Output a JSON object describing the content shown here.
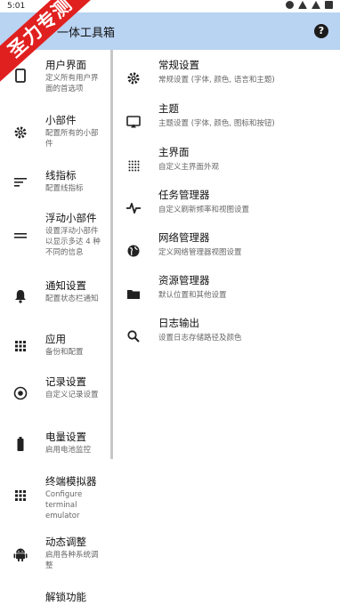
{
  "status_bar": {
    "time": "5:01"
  },
  "app": {
    "title": "一体工具箱",
    "help_glyph": "?"
  },
  "watermark": {
    "text": "圣力专测"
  },
  "left_nav": [
    {
      "title": "用户界面",
      "subtitle": "定义所有用户界面的首选项",
      "icon": "phone-icon"
    },
    {
      "title": "小部件",
      "subtitle": "配置所有的小部件",
      "icon": "gear-icon"
    },
    {
      "title": "线指标",
      "subtitle": "配置线指标",
      "icon": "lines-icon"
    },
    {
      "title": "浮动小部件",
      "subtitle": "设置浮动小部件以显示多达 4 种不同的信息",
      "icon": "equals-icon"
    },
    {
      "title": "通知设置",
      "subtitle": "配置状态栏通知",
      "icon": "bell-icon"
    },
    {
      "title": "应用",
      "subtitle": "备份和配置",
      "icon": "grid-icon"
    },
    {
      "title": "记录设置",
      "subtitle": "自定义记录设置",
      "icon": "record-icon"
    },
    {
      "title": "电量设置",
      "subtitle": "启用电池监控",
      "icon": "battery-icon"
    },
    {
      "title": "终端模拟器",
      "subtitle": "Configure terminal emulator",
      "icon": "terminal-grid-icon"
    },
    {
      "title": "动态调整",
      "subtitle": "启用各种系统调整",
      "icon": "android-icon"
    },
    {
      "title": "解锁功能",
      "subtitle": "",
      "icon": "unlock-icon"
    }
  ],
  "right_list": [
    {
      "title": "常规设置",
      "subtitle": "常规设置 (字体, 颜色, 语言和主题)",
      "icon": "gear-icon"
    },
    {
      "title": "主题",
      "subtitle": "主题设置 (字体, 颜色, 图标和按钮)",
      "icon": "cast-icon"
    },
    {
      "title": "主界面",
      "subtitle": "自定义主界面外观",
      "icon": "dots-grid-icon"
    },
    {
      "title": "任务管理器",
      "subtitle": "自定义刷新频率和视图设置",
      "icon": "pulse-icon"
    },
    {
      "title": "网络管理器",
      "subtitle": "定义网络管理器视图设置",
      "icon": "globe-icon"
    },
    {
      "title": "资源管理器",
      "subtitle": "默认位置和其他设置",
      "icon": "folder-icon"
    },
    {
      "title": "日志输出",
      "subtitle": "设置日志存储路径及颜色",
      "icon": "search-icon"
    }
  ]
}
